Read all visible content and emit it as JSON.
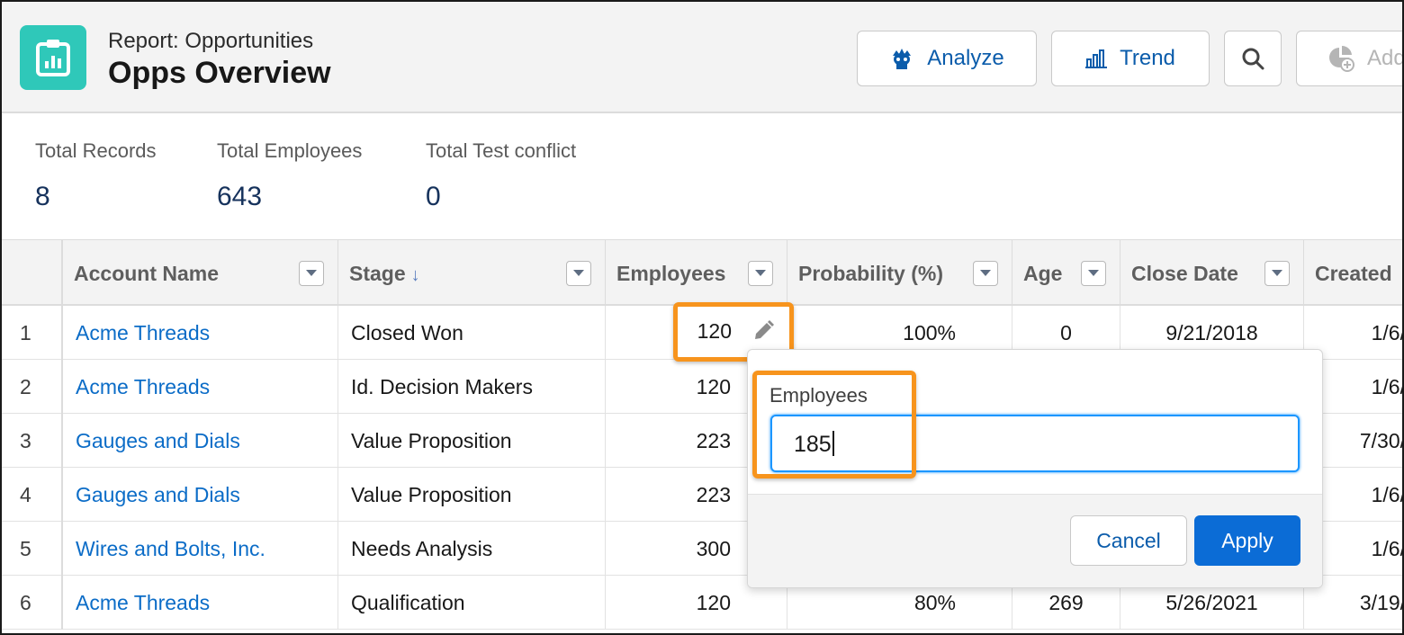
{
  "header": {
    "subtitle": "Report: Opportunities",
    "title": "Opps Overview",
    "buttons": {
      "analyze": "Analyze",
      "trend": "Trend",
      "add": "Add"
    }
  },
  "summary": [
    {
      "label": "Total Records",
      "value": "8"
    },
    {
      "label": "Total Employees",
      "value": "643"
    },
    {
      "label": "Total Test conflict",
      "value": "0"
    }
  ],
  "table": {
    "columns": [
      "Account Name",
      "Stage",
      "Employees",
      "Probability (%)",
      "Age",
      "Close Date",
      "Created"
    ],
    "sort_indicator": "↓",
    "rows": [
      {
        "num": "1",
        "account": "Acme Threads",
        "stage": "Closed Won",
        "employees": "120",
        "probability": "100%",
        "age": "0",
        "close_date": "9/21/2018",
        "created": "1/6/"
      },
      {
        "num": "2",
        "account": "Acme Threads",
        "stage": "Id. Decision Makers",
        "employees": "120",
        "probability": "",
        "age": "",
        "close_date": "",
        "created": "1/6/"
      },
      {
        "num": "3",
        "account": "Gauges and Dials",
        "stage": "Value Proposition",
        "employees": "223",
        "probability": "",
        "age": "",
        "close_date": "",
        "created": "7/30/"
      },
      {
        "num": "4",
        "account": "Gauges and Dials",
        "stage": "Value Proposition",
        "employees": "223",
        "probability": "",
        "age": "",
        "close_date": "",
        "created": "1/6/"
      },
      {
        "num": "5",
        "account": "Wires and Bolts, Inc.",
        "stage": "Needs Analysis",
        "employees": "300",
        "probability": "",
        "age": "",
        "close_date": "",
        "created": "1/6/"
      },
      {
        "num": "6",
        "account": "Acme Threads",
        "stage": "Qualification",
        "employees": "120",
        "probability": "80%",
        "age": "269",
        "close_date": "5/26/2021",
        "created": "3/19/"
      }
    ]
  },
  "editor": {
    "field_label": "Employees",
    "value": "185",
    "cancel_label": "Cancel",
    "apply_label": "Apply"
  },
  "colors": {
    "brand_icon": "#2fc8b9",
    "link": "#0b6cc7",
    "highlight": "#f7941d",
    "apply": "#0b6cd6"
  }
}
